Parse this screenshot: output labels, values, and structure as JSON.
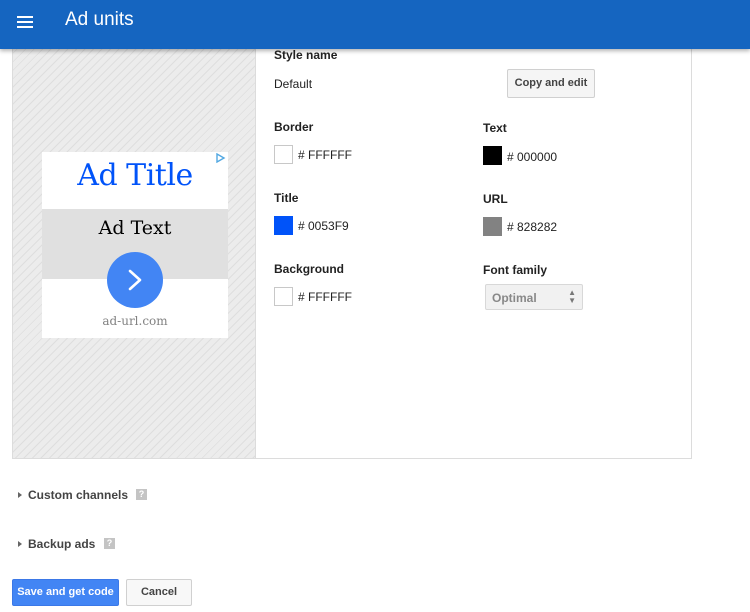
{
  "header": {
    "title": "Ad units",
    "menu_icon": "hamburger-menu-icon"
  },
  "preview": {
    "ad_title": "Ad Title",
    "ad_text": "Ad Text",
    "ad_url": "ad-url.com",
    "adchoices_icon": "adchoices-icon",
    "go_icon": "chevron-right-icon"
  },
  "style": {
    "style_name_label": "Style name",
    "style_name_value": "Default",
    "copy_edit_label": "Copy and edit",
    "border_label": "Border",
    "border_hex": "# FFFFFF",
    "border_color": "#FFFFFF",
    "text_label": "Text",
    "text_hex": "# 000000",
    "text_color": "#000000",
    "title_label": "Title",
    "title_hex": "# 0053F9",
    "title_color": "#0053F9",
    "url_label": "URL",
    "url_hex": "# 828282",
    "url_color": "#828282",
    "background_label": "Background",
    "background_hex": "# FFFFFF",
    "background_color": "#FFFFFF",
    "font_family_label": "Font family",
    "font_family_value": "Optimal"
  },
  "sections": {
    "custom_channels": "Custom channels",
    "backup_ads": "Backup ads",
    "help_icon": "help-icon"
  },
  "actions": {
    "save_label": "Save and get code",
    "cancel_label": "Cancel"
  },
  "colors": {
    "header_bg": "#1565C0",
    "primary": "#4285F4"
  }
}
